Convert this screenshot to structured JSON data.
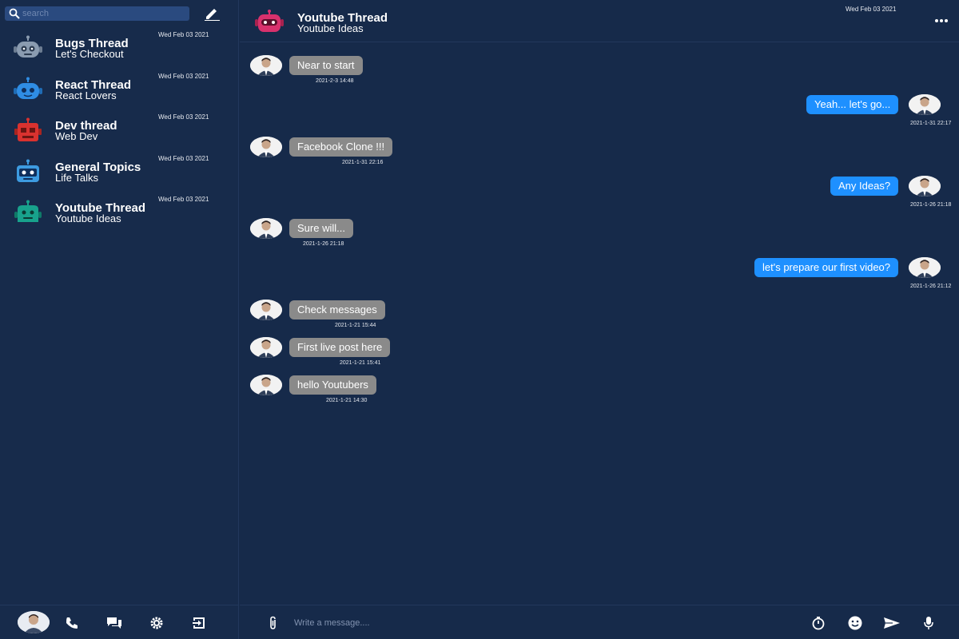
{
  "sidebar": {
    "search_placeholder": "search",
    "threads": [
      {
        "name": "Bugs Thread",
        "subtitle": "Let's Checkout",
        "date": "Wed Feb 03 2021",
        "icon": "robot-gray-icon",
        "color": "#8a9bb0"
      },
      {
        "name": "React Thread",
        "subtitle": "React Lovers",
        "date": "Wed Feb 03 2021",
        "icon": "robot-blue-icon",
        "color": "#2f8de4"
      },
      {
        "name": "Dev thread",
        "subtitle": "Web Dev",
        "date": "Wed Feb 03 2021",
        "icon": "robot-red-icon",
        "color": "#d9322f"
      },
      {
        "name": "General Topics",
        "subtitle": "Life Talks",
        "date": "Wed Feb 03 2021",
        "icon": "robot-lightblue-icon",
        "color": "#3d9be0"
      },
      {
        "name": "Youtube Thread",
        "subtitle": "Youtube Ideas",
        "date": "Wed Feb 03 2021",
        "icon": "robot-teal-icon",
        "color": "#18a28c"
      }
    ],
    "footer_icons": [
      "phone-icon",
      "chat-icon",
      "gear-icon",
      "exit-icon"
    ]
  },
  "header": {
    "title": "Youtube Thread",
    "subtitle": "Youtube Ideas",
    "date": "Wed Feb 03 2021",
    "icon": "robot-pink-icon",
    "color": "#d9316d"
  },
  "messages": [
    {
      "text": "Near to start",
      "time": "2021-2-3 14:48",
      "side": "in"
    },
    {
      "text": "Yeah... let's go...",
      "time": "2021-1-31 22:17",
      "side": "out"
    },
    {
      "text": "Facebook Clone !!!",
      "time": "2021-1-31 22:16",
      "side": "in"
    },
    {
      "text": "Any Ideas?",
      "time": "2021-1-26 21:18",
      "side": "out"
    },
    {
      "text": "Sure will...",
      "time": "2021-1-26 21:18",
      "side": "in"
    },
    {
      "text": "let's prepare our first video?",
      "time": "2021-1-26 21:12",
      "side": "out"
    },
    {
      "text": "Check messages",
      "time": "2021-1-21 15:44",
      "side": "in"
    },
    {
      "text": "First live post here",
      "time": "2021-1-21 15:41",
      "side": "in"
    },
    {
      "text": "hello Youtubers",
      "time": "2021-1-21 14:30",
      "side": "in"
    }
  ],
  "composer": {
    "placeholder": "Write a message....",
    "icons": [
      "paperclip-icon",
      "timer-icon",
      "emoji-icon",
      "send-icon",
      "microphone-icon"
    ]
  },
  "colors": {
    "background": "#162a4a",
    "incoming_bubble": "#8a8a8a",
    "outgoing_bubble": "#1e90ff",
    "search_bg": "#2a4a7f"
  }
}
